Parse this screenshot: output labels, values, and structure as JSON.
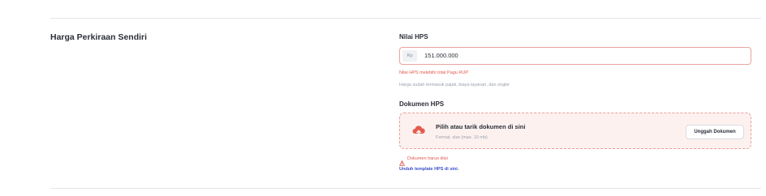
{
  "section": {
    "title": "Harga Perkiraan Sendiri"
  },
  "hps": {
    "label": "Nilai HPS",
    "prefix": "Rp",
    "value": "151.000.000",
    "error": "Nilai HPS melebihi total Pagu RUP",
    "helper": "Harga sudah termasuk pajak, biaya layanan, dan ongkir"
  },
  "document": {
    "label": "Dokumen HPS",
    "upload_title": "Pilih atau tarik dokumen di sini",
    "upload_hint": "Format .xlsx (max. 10 mb)",
    "upload_button": "Unggah Dokumen",
    "error": "Dokumen harus diisi",
    "template_link": "Unduh template HPS di sini."
  },
  "colors": {
    "error": "#e0584f",
    "link": "#3a4fc8",
    "upload_bg": "#fdf1f0"
  },
  "icons": {
    "upload": "cloud-upload-icon",
    "warning": "warning-triangle-icon"
  }
}
